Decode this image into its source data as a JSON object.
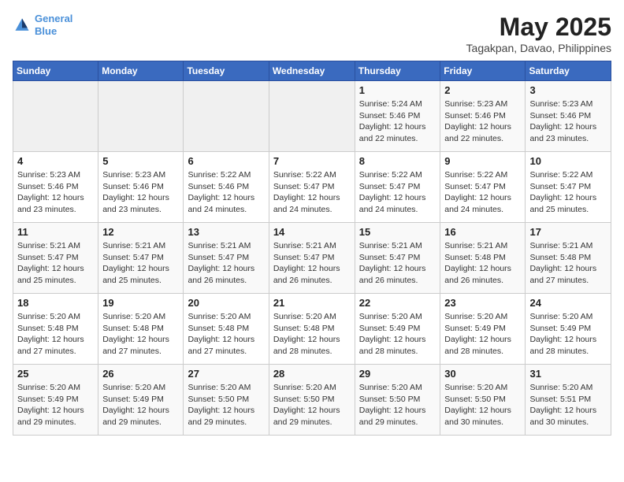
{
  "header": {
    "logo_line1": "General",
    "logo_line2": "Blue",
    "title": "May 2025",
    "subtitle": "Tagakpan, Davao, Philippines"
  },
  "weekdays": [
    "Sunday",
    "Monday",
    "Tuesday",
    "Wednesday",
    "Thursday",
    "Friday",
    "Saturday"
  ],
  "weeks": [
    [
      {
        "day": "",
        "info": ""
      },
      {
        "day": "",
        "info": ""
      },
      {
        "day": "",
        "info": ""
      },
      {
        "day": "",
        "info": ""
      },
      {
        "day": "1",
        "info": "Sunrise: 5:24 AM\nSunset: 5:46 PM\nDaylight: 12 hours\nand 22 minutes."
      },
      {
        "day": "2",
        "info": "Sunrise: 5:23 AM\nSunset: 5:46 PM\nDaylight: 12 hours\nand 22 minutes."
      },
      {
        "day": "3",
        "info": "Sunrise: 5:23 AM\nSunset: 5:46 PM\nDaylight: 12 hours\nand 23 minutes."
      }
    ],
    [
      {
        "day": "4",
        "info": "Sunrise: 5:23 AM\nSunset: 5:46 PM\nDaylight: 12 hours\nand 23 minutes."
      },
      {
        "day": "5",
        "info": "Sunrise: 5:23 AM\nSunset: 5:46 PM\nDaylight: 12 hours\nand 23 minutes."
      },
      {
        "day": "6",
        "info": "Sunrise: 5:22 AM\nSunset: 5:46 PM\nDaylight: 12 hours\nand 24 minutes."
      },
      {
        "day": "7",
        "info": "Sunrise: 5:22 AM\nSunset: 5:47 PM\nDaylight: 12 hours\nand 24 minutes."
      },
      {
        "day": "8",
        "info": "Sunrise: 5:22 AM\nSunset: 5:47 PM\nDaylight: 12 hours\nand 24 minutes."
      },
      {
        "day": "9",
        "info": "Sunrise: 5:22 AM\nSunset: 5:47 PM\nDaylight: 12 hours\nand 24 minutes."
      },
      {
        "day": "10",
        "info": "Sunrise: 5:22 AM\nSunset: 5:47 PM\nDaylight: 12 hours\nand 25 minutes."
      }
    ],
    [
      {
        "day": "11",
        "info": "Sunrise: 5:21 AM\nSunset: 5:47 PM\nDaylight: 12 hours\nand 25 minutes."
      },
      {
        "day": "12",
        "info": "Sunrise: 5:21 AM\nSunset: 5:47 PM\nDaylight: 12 hours\nand 25 minutes."
      },
      {
        "day": "13",
        "info": "Sunrise: 5:21 AM\nSunset: 5:47 PM\nDaylight: 12 hours\nand 26 minutes."
      },
      {
        "day": "14",
        "info": "Sunrise: 5:21 AM\nSunset: 5:47 PM\nDaylight: 12 hours\nand 26 minutes."
      },
      {
        "day": "15",
        "info": "Sunrise: 5:21 AM\nSunset: 5:47 PM\nDaylight: 12 hours\nand 26 minutes."
      },
      {
        "day": "16",
        "info": "Sunrise: 5:21 AM\nSunset: 5:48 PM\nDaylight: 12 hours\nand 26 minutes."
      },
      {
        "day": "17",
        "info": "Sunrise: 5:21 AM\nSunset: 5:48 PM\nDaylight: 12 hours\nand 27 minutes."
      }
    ],
    [
      {
        "day": "18",
        "info": "Sunrise: 5:20 AM\nSunset: 5:48 PM\nDaylight: 12 hours\nand 27 minutes."
      },
      {
        "day": "19",
        "info": "Sunrise: 5:20 AM\nSunset: 5:48 PM\nDaylight: 12 hours\nand 27 minutes."
      },
      {
        "day": "20",
        "info": "Sunrise: 5:20 AM\nSunset: 5:48 PM\nDaylight: 12 hours\nand 27 minutes."
      },
      {
        "day": "21",
        "info": "Sunrise: 5:20 AM\nSunset: 5:48 PM\nDaylight: 12 hours\nand 28 minutes."
      },
      {
        "day": "22",
        "info": "Sunrise: 5:20 AM\nSunset: 5:49 PM\nDaylight: 12 hours\nand 28 minutes."
      },
      {
        "day": "23",
        "info": "Sunrise: 5:20 AM\nSunset: 5:49 PM\nDaylight: 12 hours\nand 28 minutes."
      },
      {
        "day": "24",
        "info": "Sunrise: 5:20 AM\nSunset: 5:49 PM\nDaylight: 12 hours\nand 28 minutes."
      }
    ],
    [
      {
        "day": "25",
        "info": "Sunrise: 5:20 AM\nSunset: 5:49 PM\nDaylight: 12 hours\nand 29 minutes."
      },
      {
        "day": "26",
        "info": "Sunrise: 5:20 AM\nSunset: 5:49 PM\nDaylight: 12 hours\nand 29 minutes."
      },
      {
        "day": "27",
        "info": "Sunrise: 5:20 AM\nSunset: 5:50 PM\nDaylight: 12 hours\nand 29 minutes."
      },
      {
        "day": "28",
        "info": "Sunrise: 5:20 AM\nSunset: 5:50 PM\nDaylight: 12 hours\nand 29 minutes."
      },
      {
        "day": "29",
        "info": "Sunrise: 5:20 AM\nSunset: 5:50 PM\nDaylight: 12 hours\nand 29 minutes."
      },
      {
        "day": "30",
        "info": "Sunrise: 5:20 AM\nSunset: 5:50 PM\nDaylight: 12 hours\nand 30 minutes."
      },
      {
        "day": "31",
        "info": "Sunrise: 5:20 AM\nSunset: 5:51 PM\nDaylight: 12 hours\nand 30 minutes."
      }
    ]
  ]
}
